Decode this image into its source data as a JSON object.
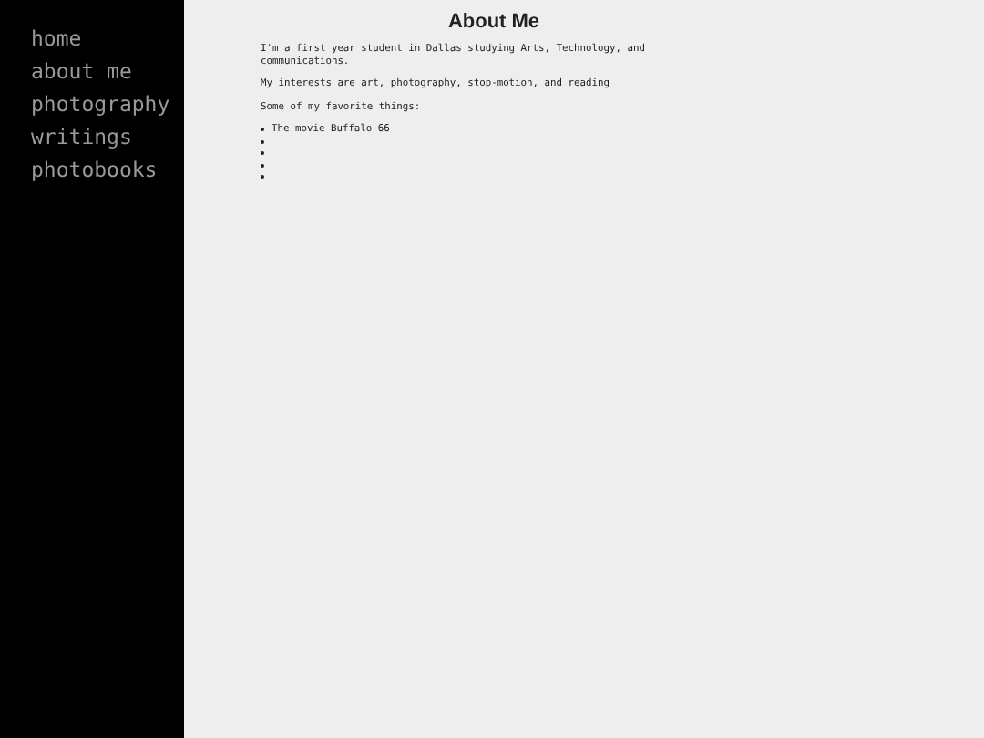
{
  "nav": [
    {
      "label": "home"
    },
    {
      "label": "about me"
    },
    {
      "label": "photography"
    },
    {
      "label": "writings"
    },
    {
      "label": "photobooks"
    }
  ],
  "heading": "About Me",
  "paragraphs": [
    "I'm a first year student in Dallas studying Arts, Technology, and communications.",
    "My interests are art, photography, stop-motion, and reading",
    "Some of my favorite things:"
  ],
  "favorites": [
    {
      "kind": "entry",
      "text": "The movie Buffalo 66"
    },
    {
      "kind": "blank"
    },
    {
      "kind": "blank"
    },
    {
      "kind": "blank"
    },
    {
      "kind": "blank"
    }
  ]
}
